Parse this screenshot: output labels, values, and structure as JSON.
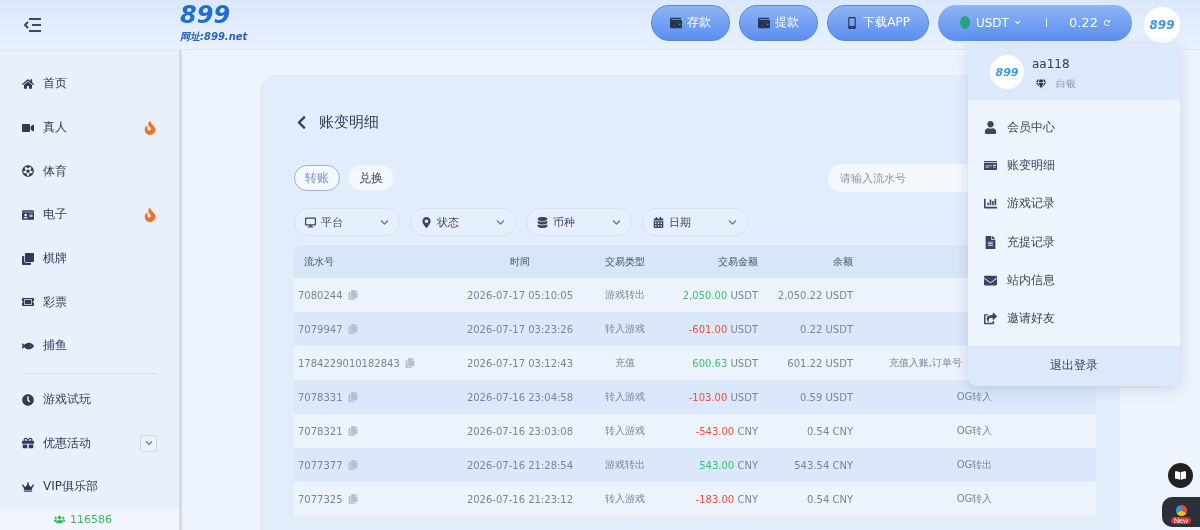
{
  "header": {
    "logo": "899",
    "logo_url": "网址:899.net",
    "buttons": [
      {
        "kind": "deposit",
        "label": "存款"
      },
      {
        "kind": "withdraw",
        "label": "提款"
      },
      {
        "kind": "app",
        "label": "下载APP"
      }
    ],
    "wallet": {
      "currency": "USDT",
      "balance": "0.22"
    },
    "avatar_logo": "899"
  },
  "sidebar": {
    "items": [
      {
        "kind": "home",
        "label": "首页",
        "hot": false
      },
      {
        "kind": "live",
        "label": "真人",
        "hot": true
      },
      {
        "kind": "sports",
        "label": "体育",
        "hot": false
      },
      {
        "kind": "slots",
        "label": "电子",
        "hot": true
      },
      {
        "kind": "cards",
        "label": "棋牌",
        "hot": false
      },
      {
        "kind": "lottery",
        "label": "彩票",
        "hot": false
      },
      {
        "kind": "fishing",
        "label": "捕鱼",
        "hot": false
      }
    ],
    "extra_items": [
      {
        "kind": "trial",
        "label": "游戏试玩"
      },
      {
        "kind": "promo",
        "label": "优惠活动",
        "expanded": false
      },
      {
        "kind": "vip",
        "label": "VIP俱乐部"
      }
    ],
    "online_count": "116586"
  },
  "page": {
    "title": "账变明细",
    "tabs": [
      {
        "label": "转账",
        "selected": true
      },
      {
        "label": "兑换",
        "selected": false
      }
    ],
    "search": {
      "placeholder": "请输入流水号"
    },
    "filters": [
      {
        "kind": "platform",
        "label": "平台"
      },
      {
        "kind": "status",
        "label": "状态"
      },
      {
        "kind": "currency",
        "label": "币种"
      },
      {
        "kind": "date",
        "label": "日期"
      }
    ],
    "table": {
      "columns": [
        "流水号",
        "时间",
        "交易类型",
        "交易金额",
        "余额"
      ],
      "rows": [
        {
          "id": "7080244",
          "time": "2026-07-17 05:10:05",
          "type": "游戏转出",
          "amount": "2,050.00",
          "color": "#3cc46a",
          "currency": "USDT",
          "balance": "2,050.22 USDT"
        },
        {
          "id": "7079947",
          "time": "2026-07-17 03:23:26",
          "type": "转入游戏",
          "amount": "-601.00",
          "color": "#e5533b",
          "currency": "USDT",
          "balance": "0.22 USDT"
        },
        {
          "id": "1784229010182843",
          "time": "2026-07-17 03:12:43",
          "type": "充值",
          "amount": "600.63",
          "color": "#3cc46a",
          "currency": "USDT",
          "balance": "601.22 USDT",
          "remark": "充值入账,订单号",
          "covered": true
        },
        {
          "id": "7078331",
          "time": "2026-07-16 23:04:58",
          "type": "转入游戏",
          "amount": "-103.00",
          "color": "#e5533b",
          "currency": "USDT",
          "balance": "0.59 USDT",
          "remark": "OG转入",
          "covered": false
        },
        {
          "id": "7078321",
          "time": "2026-07-16 23:03:08",
          "type": "转入游戏",
          "amount": "-543.00",
          "color": "#e5533b",
          "currency": "CNY",
          "balance": "0.54 CNY",
          "remark": "OG转入",
          "covered": false
        },
        {
          "id": "7077377",
          "time": "2026-07-16 21:28:54",
          "type": "游戏转出",
          "amount": "543.00",
          "color": "#3cc46a",
          "currency": "CNY",
          "balance": "543.54 CNY",
          "remark": "OG转出",
          "covered": false
        },
        {
          "id": "7077325",
          "time": "2026-07-16 21:23:12",
          "type": "转入游戏",
          "amount": "-183.00",
          "color": "#e5533b",
          "currency": "CNY",
          "balance": "0.54 CNY",
          "remark": "OG转入",
          "covered": false
        }
      ]
    }
  },
  "user_menu": {
    "avatar_logo": "899",
    "username": "aa118",
    "level": "白银",
    "items": [
      {
        "kind": "member",
        "label": "会员中心"
      },
      {
        "kind": "ledger",
        "label": "账变明细"
      },
      {
        "kind": "games",
        "label": "游戏记录"
      },
      {
        "kind": "funds",
        "label": "充提记录"
      },
      {
        "kind": "mail",
        "label": "站内信息"
      },
      {
        "kind": "invite",
        "label": "邀请好友"
      }
    ],
    "logout": "退出登录"
  },
  "floating": {
    "badge": "New"
  }
}
